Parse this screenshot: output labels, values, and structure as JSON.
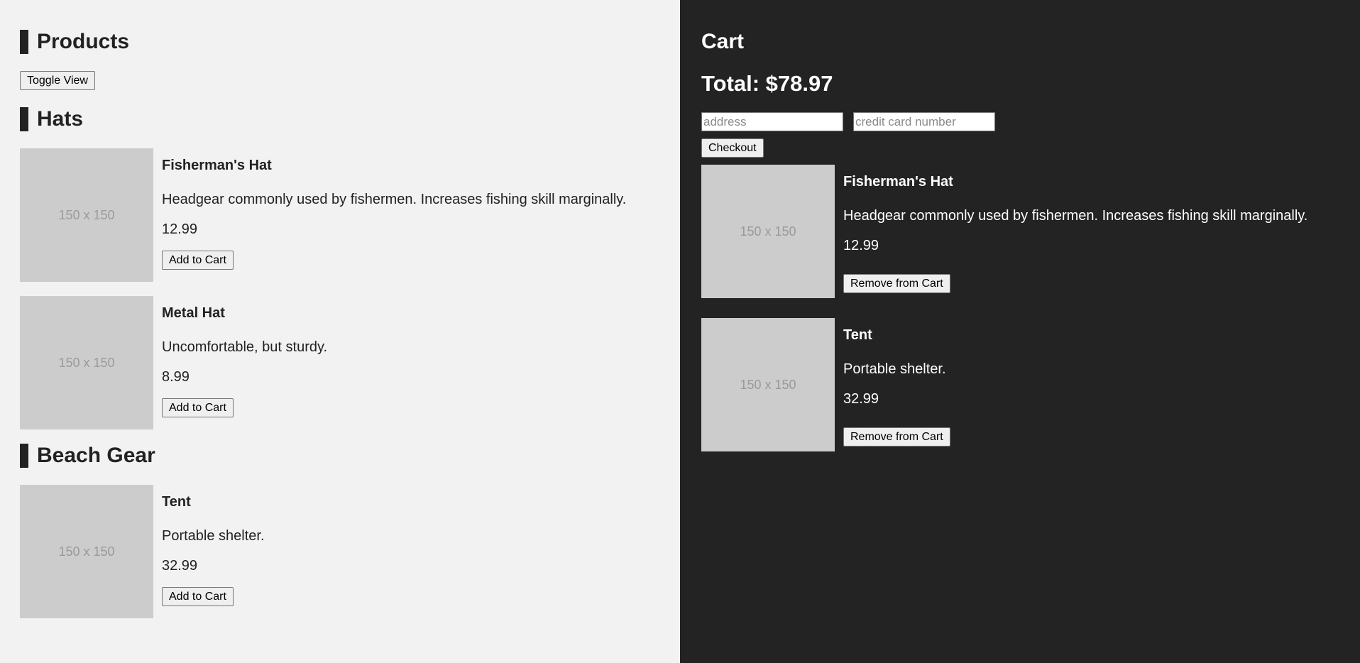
{
  "products": {
    "title": "Products",
    "toggle_label": "Toggle View",
    "categories": [
      {
        "name": "Hats",
        "items": [
          {
            "image_text": "150 x 150",
            "name": "Fisherman's Hat",
            "description": "Headgear commonly used by fishermen. Increases fishing skill marginally.",
            "price": "12.99",
            "button": "Add to Cart"
          },
          {
            "image_text": "150 x 150",
            "name": "Metal Hat",
            "description": "Uncomfortable, but sturdy.",
            "price": "8.99",
            "button": "Add to Cart"
          }
        ]
      },
      {
        "name": "Beach Gear",
        "items": [
          {
            "image_text": "150 x 150",
            "name": "Tent",
            "description": "Portable shelter.",
            "price": "32.99",
            "button": "Add to Cart"
          }
        ]
      }
    ]
  },
  "cart": {
    "title": "Cart",
    "total": "Total: $78.97",
    "address_placeholder": "address",
    "card_placeholder": "credit card number",
    "checkout_label": "Checkout",
    "items": [
      {
        "image_text": "150 x 150",
        "name": "Fisherman's Hat",
        "description": "Headgear commonly used by fishermen. Increases fishing skill marginally.",
        "price": "12.99",
        "button": "Remove from Cart"
      },
      {
        "image_text": "150 x 150",
        "name": "Tent",
        "description": "Portable shelter.",
        "price": "32.99",
        "button": "Remove from Cart"
      }
    ]
  },
  "colors": {
    "left_bg": "#f2f2f2",
    "right_bg": "#232323",
    "placeholder_image": "#cccccc"
  }
}
